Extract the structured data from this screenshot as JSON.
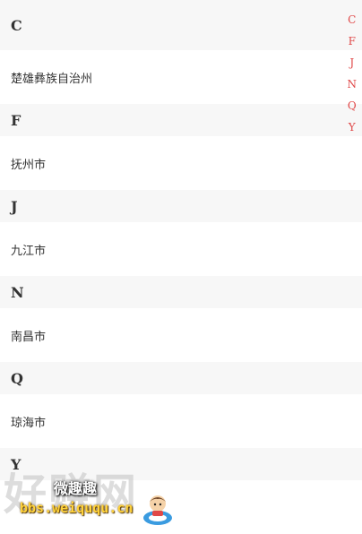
{
  "groups": [
    {
      "letter": "C",
      "city": "楚雄彝族自治州"
    },
    {
      "letter": "F",
      "city": "抚州市"
    },
    {
      "letter": "J",
      "city": "九江市"
    },
    {
      "letter": "N",
      "city": "南昌市"
    },
    {
      "letter": "Q",
      "city": "琼海市"
    },
    {
      "letter": "Y",
      "city": ""
    }
  ],
  "index_bar": [
    "C",
    "F",
    "J",
    "N",
    "Q",
    "Y"
  ],
  "colors": {
    "index_accent": "#e04848",
    "header_bg": "#f7f7f7"
  },
  "watermark": {
    "big_text": "好赚网",
    "brand": "微趣趣",
    "url": "bbs.weiququ.cn"
  }
}
